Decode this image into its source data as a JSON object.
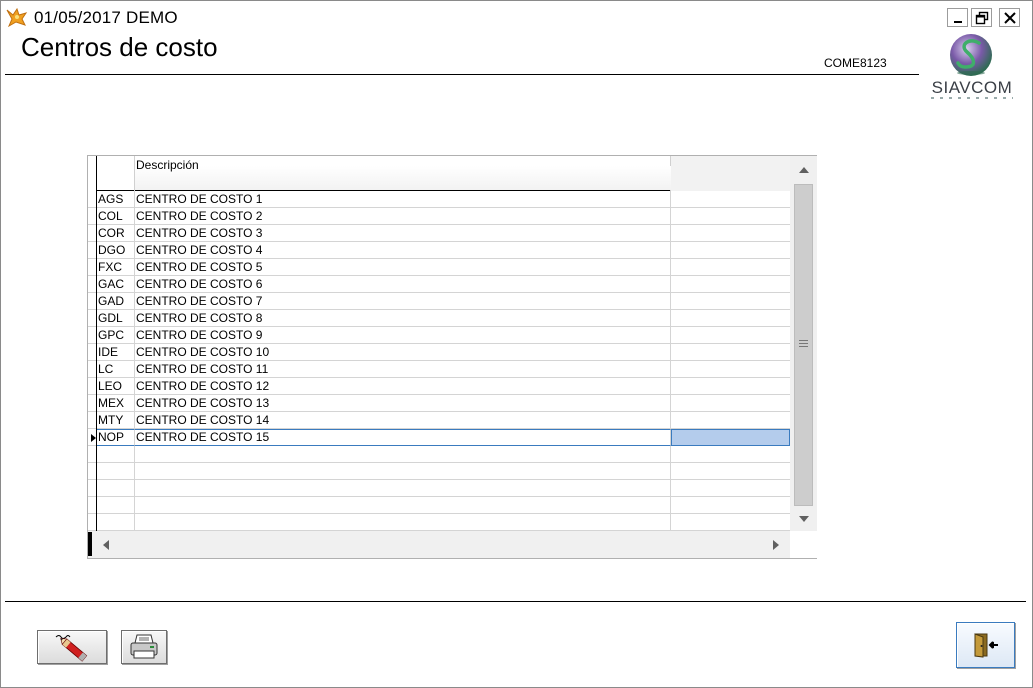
{
  "window": {
    "title": "01/05/2017  DEMO",
    "controls": [
      "minimize",
      "restore",
      "close"
    ]
  },
  "header": {
    "title": "Centros de costo",
    "form_code": "COME8123",
    "logo_text": "SIAVCOM"
  },
  "grid": {
    "columns": [
      "",
      "Descripción",
      ""
    ],
    "current_row_index": 14,
    "rows": [
      {
        "code": "AGS",
        "description": "CENTRO DE COSTO 1"
      },
      {
        "code": "COL",
        "description": "CENTRO DE COSTO 2"
      },
      {
        "code": "COR",
        "description": "CENTRO DE COSTO 3"
      },
      {
        "code": "DGO",
        "description": "CENTRO DE COSTO 4"
      },
      {
        "code": "FXC",
        "description": "CENTRO DE COSTO 5"
      },
      {
        "code": "GAC",
        "description": "CENTRO DE COSTO 6"
      },
      {
        "code": "GAD",
        "description": "CENTRO DE COSTO 7"
      },
      {
        "code": "GDL",
        "description": "CENTRO DE COSTO 8"
      },
      {
        "code": "GPC",
        "description": "CENTRO DE COSTO 9"
      },
      {
        "code": "IDE",
        "description": "CENTRO DE COSTO 10"
      },
      {
        "code": "LC",
        "description": "CENTRO DE COSTO 11"
      },
      {
        "code": "LEO",
        "description": "CENTRO DE COSTO 12"
      },
      {
        "code": "MEX",
        "description": "CENTRO DE COSTO 13"
      },
      {
        "code": "MTY",
        "description": "CENTRO DE COSTO 14"
      },
      {
        "code": "NOP",
        "description": "CENTRO DE COSTO 15"
      }
    ],
    "empty_rows": 5
  },
  "buttons": {
    "edit_icon": "pencil-icon",
    "print_icon": "printer-icon",
    "exit_icon": "exit-door-icon"
  },
  "colors": {
    "selection": "#b4ccec",
    "selection_border": "#3a7bbf",
    "logo_green": "#3e8e62",
    "logo_purple": "#5a3c8c"
  }
}
